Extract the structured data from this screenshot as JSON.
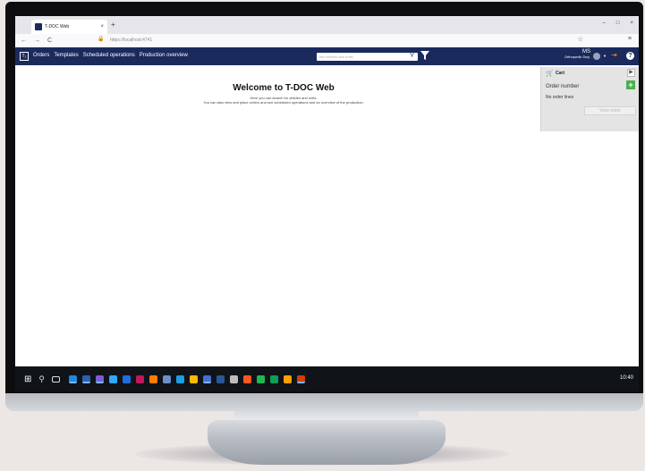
{
  "browser": {
    "tab_title": "T-DOC Web",
    "tab_close": "×",
    "new_tab": "+",
    "url": "https://localhost:4741",
    "back": "←",
    "forward": "→",
    "reload": "C",
    "window_controls": [
      "–",
      "□",
      "×"
    ]
  },
  "app": {
    "logo_text": "T₂",
    "menu": [
      "Orders",
      "Templates",
      "Scheduled operations",
      "Production overview"
    ],
    "search_placeholder": "find articles and units",
    "user_initials": "MS",
    "user_department": "Orthopedic Dep."
  },
  "welcome": {
    "title": "Welcome to T-DOC Web",
    "subtitle": "Here you can search for articles and units.",
    "description": "You can also view and place orders and see scheduled operations and an overview of the production."
  },
  "cart": {
    "title": "Cart",
    "order_number_label": "Order number",
    "empty_text": "No order lines",
    "view_order_label": "View order"
  },
  "taskbar": {
    "clock": "10:40",
    "app_colors": [
      "#1e88e5",
      "#2f5fb3",
      "#7b5cd6",
      "#31a8ff",
      "#1e6fd9",
      "#c2185b",
      "#ff7c00",
      "#6d8fc9",
      "#1ba0e2",
      "#ffb900",
      "#4a6cd4",
      "#2b579a",
      "#bdbdbd",
      "#ff5722",
      "#1db954",
      "#0f9d58",
      "#ffa000",
      "#d83b01",
      "#3a5fcd"
    ]
  }
}
